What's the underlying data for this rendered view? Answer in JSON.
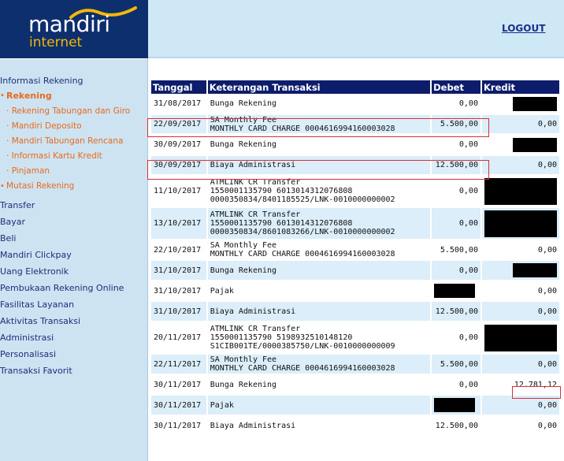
{
  "header": {
    "logo_main": "mandiri",
    "logo_sub": "internet",
    "logout_label": "LOGOUT"
  },
  "sidebar": {
    "section_title": "Informasi Rekening",
    "rekening_label": "Rekening",
    "sub_items": [
      "Rekening Tabungan dan Giro",
      "Mandiri Deposito",
      "Mandiri Tabungan Rencana",
      "Informasi Kartu Kredit",
      "Pinjaman"
    ],
    "mutasi_label": "Mutasi Rekening",
    "menu": [
      "Transfer",
      "Bayar",
      "Beli",
      "Mandiri Clickpay",
      "Uang Elektronik",
      "Pembukaan Rekening Online",
      "Fasilitas Layanan",
      "Aktivitas Transaksi",
      "Administrasi",
      "Personalisasi",
      "Transaksi Favorit"
    ]
  },
  "table": {
    "headers": [
      "Tanggal",
      "Keterangan Transaksi",
      "Debet",
      "Kredit"
    ],
    "rows": [
      {
        "date": "31/08/2017",
        "desc1": "Bunga Rekening",
        "desc2": "",
        "desc3": "",
        "debet": "0,00",
        "kredit": "",
        "kredit_redacted": true,
        "debet_redacted": false
      },
      {
        "date": "22/09/2017",
        "desc1": "SA Monthly Fee",
        "desc2": "MONTHLY CARD CHARGE 0004616994160003028",
        "desc3": "",
        "debet": "5.500,00",
        "kredit": "0,00",
        "kredit_redacted": false,
        "debet_redacted": false
      },
      {
        "date": "30/09/2017",
        "desc1": "Bunga Rekening",
        "desc2": "",
        "desc3": "",
        "debet": "0,00",
        "kredit": "",
        "kredit_redacted": true,
        "debet_redacted": false
      },
      {
        "date": "30/09/2017",
        "desc1": "Biaya Administrasi",
        "desc2": "",
        "desc3": "",
        "debet": "12.500,00",
        "kredit": "0,00",
        "kredit_redacted": false,
        "debet_redacted": false
      },
      {
        "date": "11/10/2017",
        "desc1": "ATMLINK CR Transfer",
        "desc2": "1550001135790 6013014312076808",
        "desc3": "0000350834/8401185525/LNK-0010000000002",
        "debet": "0,00",
        "kredit": "",
        "kredit_redacted": true,
        "debet_redacted": false
      },
      {
        "date": "13/10/2017",
        "desc1": "ATMLINK CR Transfer",
        "desc2": "1550001135790 6013014312076808",
        "desc3": "0000350834/8601083266/LNK-0010000000002",
        "debet": "0,00",
        "kredit": "",
        "kredit_redacted": true,
        "debet_redacted": false
      },
      {
        "date": "22/10/2017",
        "desc1": "SA Monthly Fee",
        "desc2": "MONTHLY CARD CHARGE 0004616994160003028",
        "desc3": "",
        "debet": "5.500,00",
        "kredit": "0,00",
        "kredit_redacted": false,
        "debet_redacted": false
      },
      {
        "date": "31/10/2017",
        "desc1": "Bunga Rekening",
        "desc2": "",
        "desc3": "",
        "debet": "0,00",
        "kredit": "",
        "kredit_redacted": true,
        "debet_redacted": false
      },
      {
        "date": "31/10/2017",
        "desc1": "Pajak",
        "desc2": "",
        "desc3": "",
        "debet": "",
        "kredit": "0,00",
        "kredit_redacted": false,
        "debet_redacted": true
      },
      {
        "date": "31/10/2017",
        "desc1": "Biaya Administrasi",
        "desc2": "",
        "desc3": "",
        "debet": "12.500,00",
        "kredit": "0,00",
        "kredit_redacted": false,
        "debet_redacted": false
      },
      {
        "date": "20/11/2017",
        "desc1": "ATMLINK CR Transfer",
        "desc2": "1550001135790 5198932510148120",
        "desc3": "S1CIB001TE/0000385750/LNK-0010000000009",
        "debet": "0,00",
        "kredit": "",
        "kredit_redacted": true,
        "debet_redacted": false
      },
      {
        "date": "22/11/2017",
        "desc1": "SA Monthly Fee",
        "desc2": "MONTHLY CARD CHARGE 0004616994160003028",
        "desc3": "",
        "debet": "5.500,00",
        "kredit": "0,00",
        "kredit_redacted": false,
        "debet_redacted": false
      },
      {
        "date": "30/11/2017",
        "desc1": "Bunga Rekening",
        "desc2": "",
        "desc3": "",
        "debet": "0,00",
        "kredit": "12.781,12",
        "kredit_redacted": false,
        "debet_redacted": false
      },
      {
        "date": "30/11/2017",
        "desc1": "Pajak",
        "desc2": "",
        "desc3": "",
        "debet": "",
        "kredit": "0,00",
        "kredit_redacted": false,
        "debet_redacted": true
      },
      {
        "date": "30/11/2017",
        "desc1": "Biaya Administrasi",
        "desc2": "",
        "desc3": "",
        "debet": "12.500,00",
        "kredit": "0,00",
        "kredit_redacted": false,
        "debet_redacted": false
      }
    ]
  },
  "colors": {
    "header_bg": "#0d1c6b",
    "row_alt": "#dbeef9",
    "sidebar_bg": "#cde3f2",
    "accent_orange": "#e86a1a",
    "highlight_red": "#d9303a"
  }
}
